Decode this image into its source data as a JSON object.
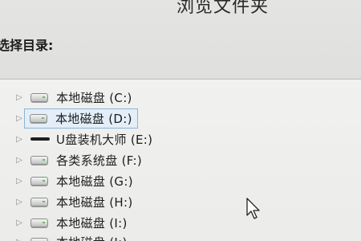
{
  "dialog": {
    "title": "浏览文件夹",
    "prompt": "选择目录:"
  },
  "tree": {
    "items": [
      {
        "label": "本地磁盘 (C:)",
        "icon": "hard-drive-icon",
        "selected": false
      },
      {
        "label": "本地磁盘 (D:)",
        "icon": "hard-drive-icon",
        "selected": true
      },
      {
        "label": "U盘装机大师 (E:)",
        "icon": "usb-drive-icon",
        "selected": false
      },
      {
        "label": "各类系统盘 (F:)",
        "icon": "hard-drive-icon",
        "selected": false
      },
      {
        "label": "本地磁盘 (G:)",
        "icon": "hard-drive-icon",
        "selected": false
      },
      {
        "label": "本地磁盘 (H:)",
        "icon": "hard-drive-icon",
        "selected": false
      },
      {
        "label": "本地磁盘 (I:)",
        "icon": "hard-drive-icon",
        "selected": false
      },
      {
        "label": "本地磁盘 (J:)",
        "icon": "hard-drive-icon",
        "selected": false
      }
    ]
  },
  "colors": {
    "selection_bg": "#e3eef9",
    "selection_border": "#8fb4d6"
  }
}
